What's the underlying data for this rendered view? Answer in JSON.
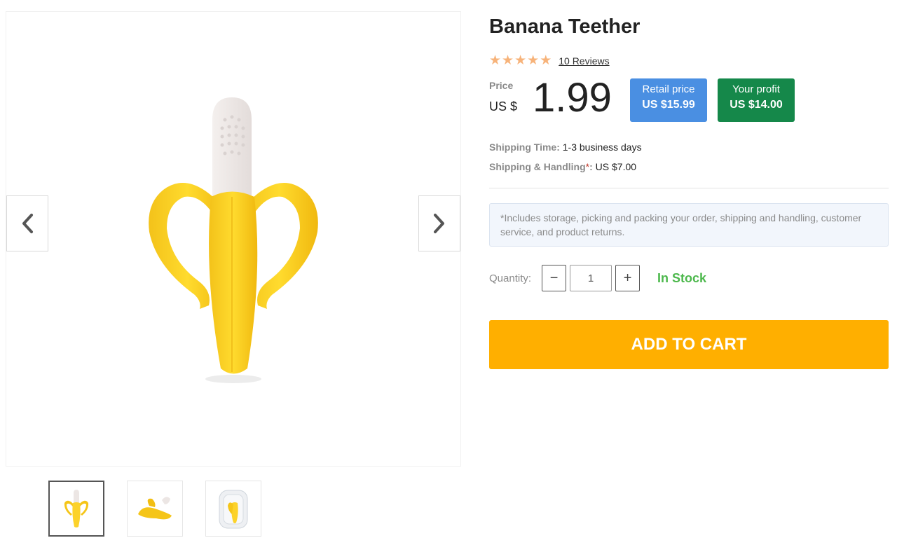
{
  "product": {
    "title": "Banana Teether",
    "rating": 5,
    "reviews_label": "10 Reviews"
  },
  "price": {
    "label": "Price",
    "currency": "US $",
    "amount": "1.99"
  },
  "badges": {
    "retail_label": "Retail price",
    "retail_value": "US $15.99",
    "profit_label": "Your profit",
    "profit_value": "US $14.00"
  },
  "shipping": {
    "time_key": "Shipping Time:",
    "time_value": "1-3 business days",
    "handling_key": "Shipping & Handling",
    "handling_asterisk": "*",
    "handling_colon": ":",
    "handling_value": "US $7.00"
  },
  "note": "*Includes storage, picking and packing your order, shipping and handling, customer service, and product returns.",
  "quantity": {
    "label": "Quantity:",
    "value": "1",
    "minus": "−",
    "plus": "+"
  },
  "stock_status": "In Stock",
  "add_to_cart": "ADD TO CART",
  "colors": {
    "star": "#f7b37a",
    "retail_badge": "#4a8fe2",
    "profit_badge": "#15884a",
    "in_stock": "#4cb84c",
    "add_to_cart": "#ffaf00"
  },
  "icons": {
    "prev": "chevron-left-icon",
    "next": "chevron-right-icon",
    "star": "star-icon"
  }
}
